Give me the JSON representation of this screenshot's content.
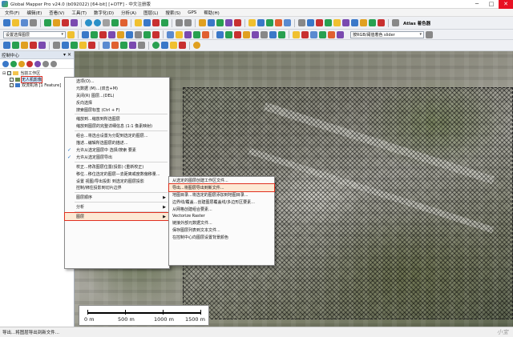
{
  "window": {
    "title": "Global Mapper Pro v24.0 (b092022) [64-bit] [+DTF] - 中文注册版",
    "min": "─",
    "max": "□",
    "close": "✕"
  },
  "menubar": [
    "文件(F)",
    "编辑(E)",
    "查看(V)",
    "工具(T)",
    "数字化(D)",
    "分析(A)",
    "图层(L)",
    "搜索(S)",
    "GPS",
    "帮助(H)"
  ],
  "toolbar": {
    "shader_label": "Atlas 着色器",
    "layer_combo": "设置选择图层",
    "shader_combo": "按RGB/阈值着色 slider",
    "accent_colors": [
      "#3a78c8",
      "#e0a020",
      "#28a050",
      "#c83030",
      "#7a4ab0",
      "#f0c030"
    ]
  },
  "control_center": {
    "title": "控制中心",
    "pin": "▾ ✕",
    "tree": [
      {
        "label": "当前工作区",
        "type": "folder",
        "checked": true
      },
      {
        "label": "无人机影像",
        "type": "raster",
        "checked": true,
        "selected": true
      },
      {
        "label": "双流机场 [1 Feature]",
        "type": "vector",
        "checked": true
      }
    ]
  },
  "context_menu": {
    "items": [
      {
        "label": "选项(O)..."
      },
      {
        "label": "元数据 (M)...(双击+M)"
      },
      {
        "label": "关闭(R) 图层...(DEL)"
      },
      {
        "label": "反向选择"
      },
      {
        "label": "搜索图层标签 (Ctrl + F)"
      },
      {
        "sep": true
      },
      {
        "label": "缩放到...缩放到所选图层"
      },
      {
        "label": "缩放到图层的完整详细信息 (1:1 像素映射)"
      },
      {
        "sep": true
      },
      {
        "label": "组合...将选合设置为分配到选定的图层..."
      },
      {
        "label": "描述...编辑所选图层的描述..."
      },
      {
        "label": "允许从选定图层中 选择/搜索 要素",
        "check": true
      },
      {
        "label": "允许从选定图层导出",
        "check": true
      },
      {
        "sep": true
      },
      {
        "label": "校正...修改图层位置(投影) (重新校正)"
      },
      {
        "label": "移位...移位选定的图层—去距离或度数偏移量..."
      },
      {
        "label": "设置 视图/导出投影 到选定的图层投影"
      },
      {
        "label": "控制/绑住投影到切片边界"
      },
      {
        "sep": true
      },
      {
        "label": "图层顺序",
        "sub": true
      },
      {
        "sep": true
      },
      {
        "label": "分析",
        "sub": true
      },
      {
        "sep": true
      },
      {
        "label": "图层",
        "sub": true,
        "highlight": true
      }
    ]
  },
  "submenu": {
    "items": [
      {
        "label": "从选定的图层创建工作区文件..."
      },
      {
        "label": "导出...将图层导出到新文件...",
        "highlight": true
      },
      {
        "label": "地图目录...将选定的图层添加到地图目录..."
      },
      {
        "label": "边界线/覆盖...创建图层覆盖线/多边形区要素..."
      },
      {
        "label": "从网格创建组合要素..."
      },
      {
        "label": "Vectorize Raster"
      },
      {
        "label": "链接外部元数据文件..."
      },
      {
        "label": "保存图层列表到文本文件..."
      },
      {
        "label": "在控制中心向图层设置背景颜色"
      }
    ]
  },
  "scalebar": {
    "labels": [
      "0 m",
      "500 m",
      "1000 m",
      "1500 m"
    ]
  },
  "status": {
    "text": "导出...将图层导出到新文件..."
  },
  "watermark": "小宝"
}
